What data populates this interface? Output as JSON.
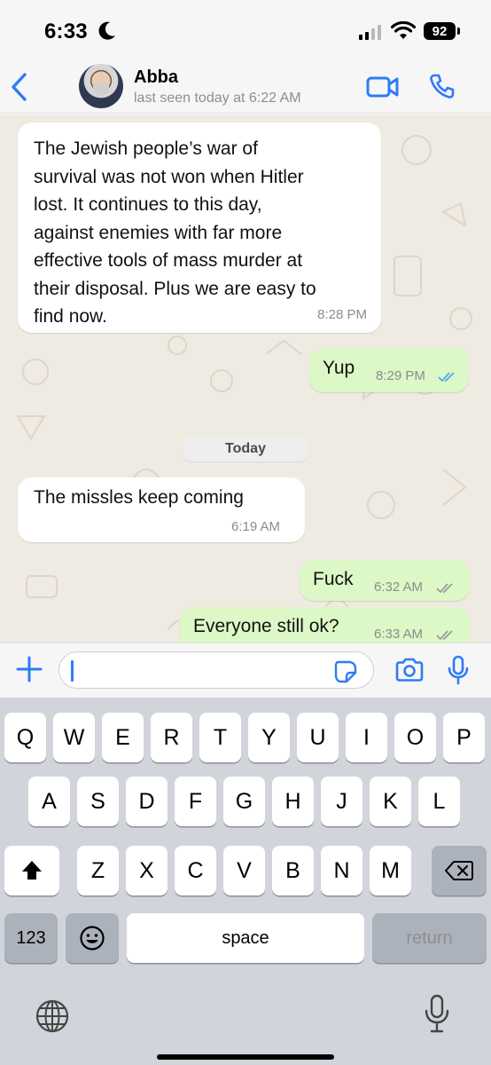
{
  "status_bar": {
    "time": "6:33",
    "focus_icon": "moon-icon",
    "signal_icon": "cellular-signal-icon",
    "wifi_icon": "wifi-icon",
    "battery_level": "92"
  },
  "header": {
    "back_icon": "chevron-left-icon",
    "contact_name": "Abba",
    "last_seen": "last seen today at 6:22 AM",
    "video_call_icon": "video-camera-icon",
    "voice_call_icon": "phone-icon"
  },
  "messages": [
    {
      "direction": "incoming",
      "text": "The Jewish people’s war of\nsurvival was not won when Hitler\nlost. It continues to this day,\nagainst enemies with far more\neffective tools of mass murder at\ntheir disposal. Plus we are easy to\nfind now.",
      "time": "8:28 PM"
    },
    {
      "direction": "outgoing",
      "text": "Yup",
      "time": "8:29 PM",
      "status": "read"
    },
    {
      "direction": "incoming",
      "text": "The missles keep coming",
      "time": "6:19 AM"
    },
    {
      "direction": "outgoing",
      "text": "Fuck",
      "time": "6:32 AM",
      "status": "delivered"
    },
    {
      "direction": "outgoing",
      "text": "Everyone still ok?",
      "time": "6:33 AM",
      "status": "delivered"
    }
  ],
  "date_separator": "Today",
  "input_bar": {
    "plus_icon": "plus-icon",
    "text_value": "",
    "sticker_icon": "sticker-icon",
    "camera_icon": "camera-icon",
    "mic_icon": "microphone-icon"
  },
  "keyboard": {
    "row1": [
      "Q",
      "W",
      "E",
      "R",
      "T",
      "Y",
      "U",
      "I",
      "O",
      "P"
    ],
    "row2": [
      "A",
      "S",
      "D",
      "F",
      "G",
      "H",
      "J",
      "K",
      "L"
    ],
    "row3": [
      "Z",
      "X",
      "C",
      "V",
      "B",
      "N",
      "M"
    ],
    "shift_icon": "shift-icon",
    "delete_icon": "backspace-icon",
    "numbers_label": "123",
    "emoji_icon": "emoji-icon",
    "space_label": "space",
    "return_label": "return",
    "globe_icon": "globe-icon",
    "dictation_icon": "microphone-icon"
  },
  "colors": {
    "accent": "#2f7bf6",
    "incoming_bubble": "#ffffff",
    "outgoing_bubble": "#dcf8c6",
    "chat_background": "#efeae2",
    "read_ticks": "#53a6f5",
    "delivered_ticks": "#9a9a9a"
  }
}
